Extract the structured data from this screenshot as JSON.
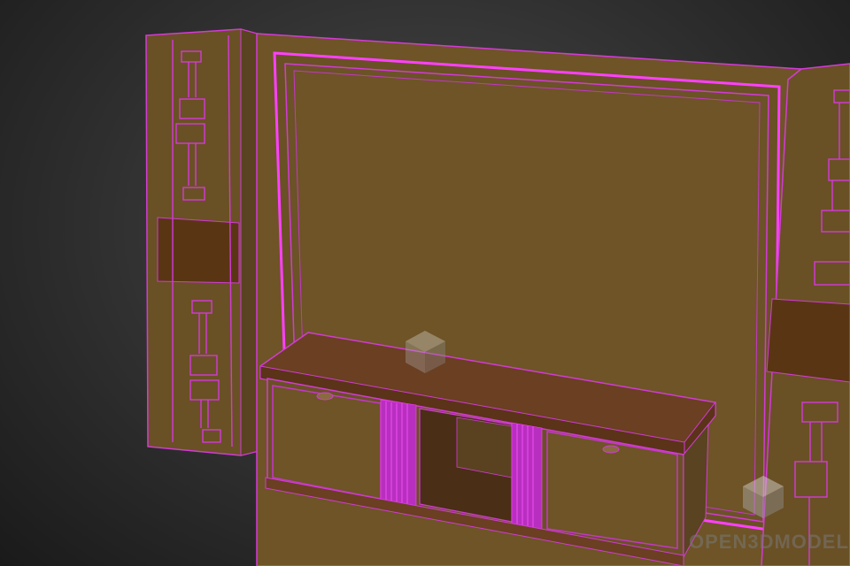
{
  "viewport": {
    "background_center": "#4a4a4a",
    "background_edge": "#1a1a1a"
  },
  "colors": {
    "wood": "#6e5426",
    "wood_light": "#7a5f2c",
    "wood_dark": "#5a4220",
    "wood_top": "#6a3f22",
    "inset_dark": "#4a2e16",
    "wire": "#d33bd6",
    "wire_bright": "#ff40ff"
  },
  "watermark": {
    "text": "OPEN3DMODEL",
    "logo_icon": "cube-logo-icon"
  }
}
